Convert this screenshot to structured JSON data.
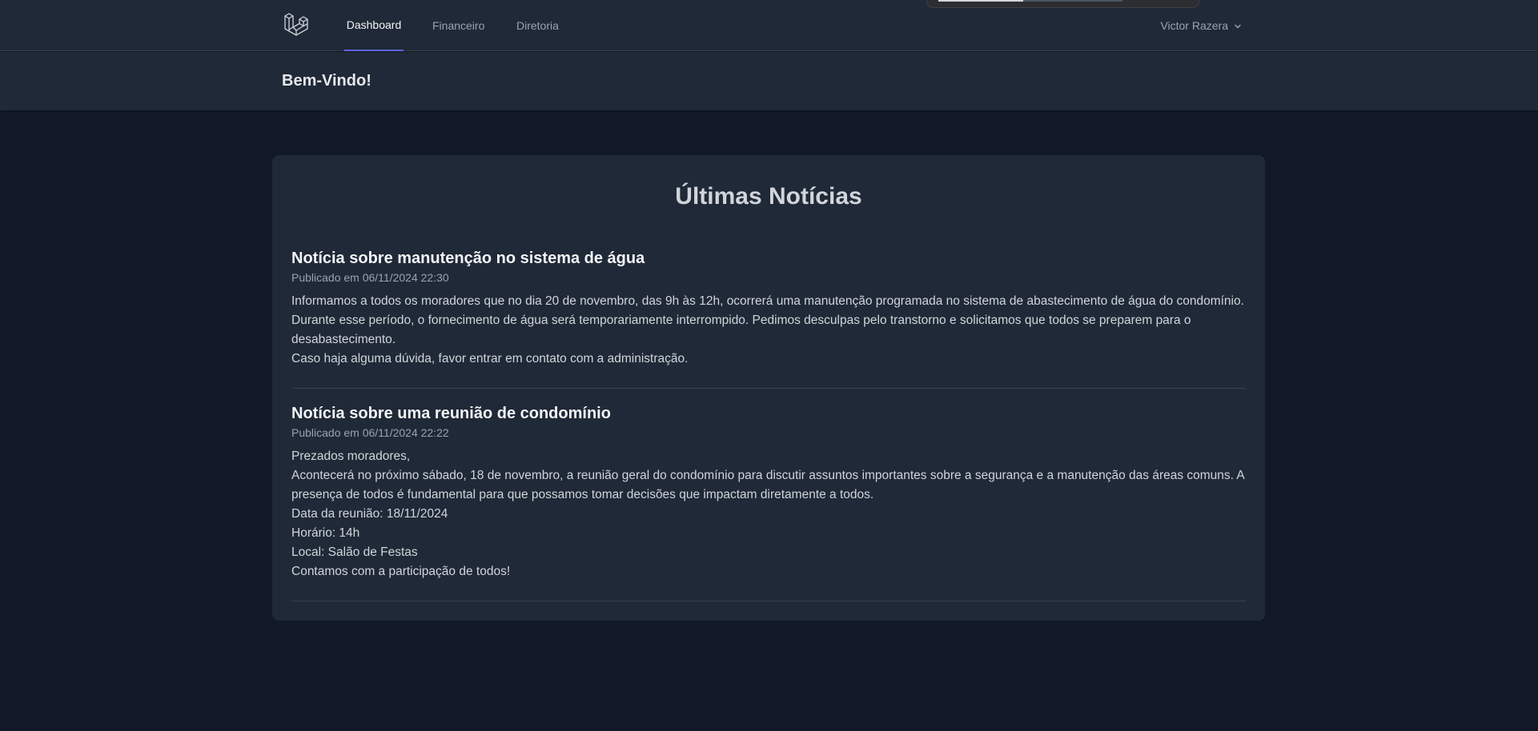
{
  "nav": {
    "logo_icon": "laravel-logo-icon",
    "links": [
      {
        "label": "Dashboard",
        "active": true
      },
      {
        "label": "Financeiro",
        "active": false
      },
      {
        "label": "Diretoria",
        "active": false
      }
    ],
    "user_name": "Victor Razera",
    "user_menu_icon": "chevron-down-icon"
  },
  "header": {
    "title": "Bem-Vindo!"
  },
  "news_section": {
    "title": "Últimas Notícias",
    "items": [
      {
        "title": "Notícia sobre manutenção no sistema de água",
        "date": "Publicado em 06/11/2024 22:30",
        "body": [
          "Informamos a todos os moradores que no dia 20 de novembro, das 9h às 12h, ocorrerá uma manutenção programada no sistema de abastecimento de água do condomínio. Durante esse período, o fornecimento de água será temporariamente interrompido. Pedimos desculpas pelo transtorno e solicitamos que todos se preparem para o desabastecimento.",
          "Caso haja alguma dúvida, favor entrar em contato com a administração."
        ]
      },
      {
        "title": "Notícia sobre uma reunião de condomínio",
        "date": "Publicado em 06/11/2024 22:22",
        "body": [
          "Prezados moradores,",
          "Acontecerá no próximo sábado, 18 de novembro, a reunião geral do condomínio para discutir assuntos importantes sobre a segurança e a manutenção das áreas comuns. A presença de todos é fundamental para que possamos tomar decisões que impactam diretamente a todos.",
          "Data da reunião: 18/11/2024",
          "Horário: 14h",
          "Local: Salão de Festas",
          "Contamos com a participação de todos!"
        ]
      }
    ]
  },
  "colors": {
    "background": "#111827",
    "surface": "#1f2937",
    "accent": "#6366f1",
    "border": "#374151"
  }
}
